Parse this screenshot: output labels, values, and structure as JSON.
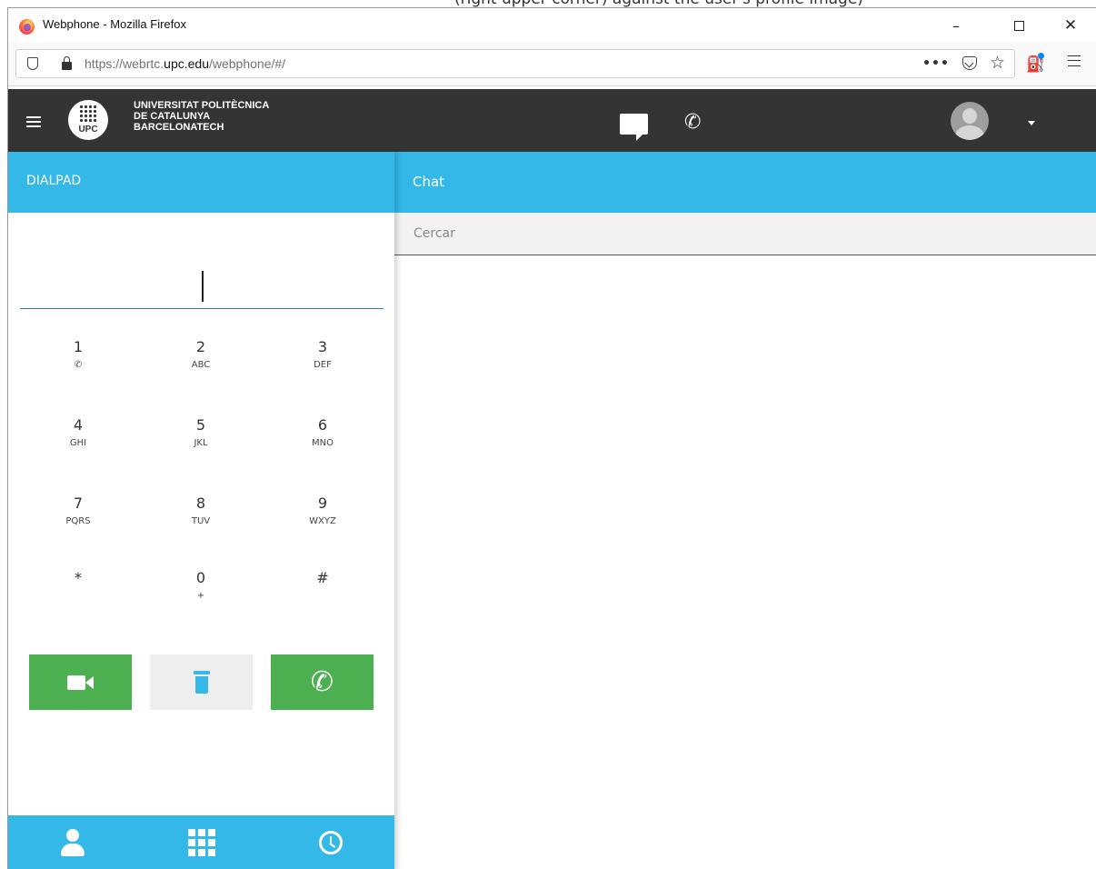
{
  "top_strip": {
    "text": "(right upper corner) against the user's profile image)"
  },
  "window": {
    "title": "Webphone - Mozilla Firefox",
    "minimize": "–",
    "close": "✕"
  },
  "navbar": {
    "url_prefix": "https://webrtc.",
    "url_host": "upc.edu",
    "url_path": "/webphone/#/",
    "page_actions": "•••",
    "star": "☆",
    "extension_icon": "⛽"
  },
  "header": {
    "logo_text": "UPC",
    "org_line1": "UNIVERSITAT POLITÈCNICA",
    "org_line2": "DE CATALUNYA",
    "org_line3": "BARCELONATECH",
    "phone_icon": "✆"
  },
  "dialpad": {
    "title": "DIALPAD",
    "keys": [
      {
        "num": "1",
        "sub": "✆"
      },
      {
        "num": "2",
        "sub": "ABC"
      },
      {
        "num": "3",
        "sub": "DEF"
      },
      {
        "num": "4",
        "sub": "GHI"
      },
      {
        "num": "5",
        "sub": "JKL"
      },
      {
        "num": "6",
        "sub": "MNO"
      },
      {
        "num": "7",
        "sub": "PQRS"
      },
      {
        "num": "8",
        "sub": "TUV"
      },
      {
        "num": "9",
        "sub": "WXYZ"
      },
      {
        "num": "*",
        "sub": ""
      },
      {
        "num": "0",
        "sub": "+"
      },
      {
        "num": "#",
        "sub": ""
      }
    ],
    "call_icon": "✆"
  },
  "chat": {
    "title": "Chat",
    "search_placeholder": "Cercar"
  },
  "colors": {
    "accent": "#33b8e8",
    "header_bg": "#343434",
    "call_green": "#4caf50"
  }
}
